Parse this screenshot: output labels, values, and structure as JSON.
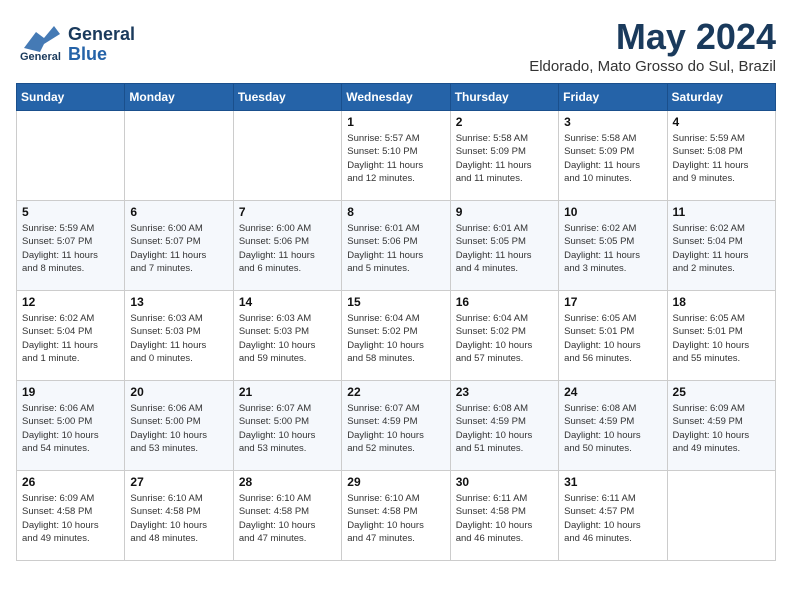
{
  "header": {
    "logo_general": "General",
    "logo_blue": "Blue",
    "month_title": "May 2024",
    "subtitle": "Eldorado, Mato Grosso do Sul, Brazil"
  },
  "days_of_week": [
    "Sunday",
    "Monday",
    "Tuesday",
    "Wednesday",
    "Thursday",
    "Friday",
    "Saturday"
  ],
  "weeks": [
    [
      {
        "day": "",
        "content": ""
      },
      {
        "day": "",
        "content": ""
      },
      {
        "day": "",
        "content": ""
      },
      {
        "day": "1",
        "content": "Sunrise: 5:57 AM\nSunset: 5:10 PM\nDaylight: 11 hours\nand 12 minutes."
      },
      {
        "day": "2",
        "content": "Sunrise: 5:58 AM\nSunset: 5:09 PM\nDaylight: 11 hours\nand 11 minutes."
      },
      {
        "day": "3",
        "content": "Sunrise: 5:58 AM\nSunset: 5:09 PM\nDaylight: 11 hours\nand 10 minutes."
      },
      {
        "day": "4",
        "content": "Sunrise: 5:59 AM\nSunset: 5:08 PM\nDaylight: 11 hours\nand 9 minutes."
      }
    ],
    [
      {
        "day": "5",
        "content": "Sunrise: 5:59 AM\nSunset: 5:07 PM\nDaylight: 11 hours\nand 8 minutes."
      },
      {
        "day": "6",
        "content": "Sunrise: 6:00 AM\nSunset: 5:07 PM\nDaylight: 11 hours\nand 7 minutes."
      },
      {
        "day": "7",
        "content": "Sunrise: 6:00 AM\nSunset: 5:06 PM\nDaylight: 11 hours\nand 6 minutes."
      },
      {
        "day": "8",
        "content": "Sunrise: 6:01 AM\nSunset: 5:06 PM\nDaylight: 11 hours\nand 5 minutes."
      },
      {
        "day": "9",
        "content": "Sunrise: 6:01 AM\nSunset: 5:05 PM\nDaylight: 11 hours\nand 4 minutes."
      },
      {
        "day": "10",
        "content": "Sunrise: 6:02 AM\nSunset: 5:05 PM\nDaylight: 11 hours\nand 3 minutes."
      },
      {
        "day": "11",
        "content": "Sunrise: 6:02 AM\nSunset: 5:04 PM\nDaylight: 11 hours\nand 2 minutes."
      }
    ],
    [
      {
        "day": "12",
        "content": "Sunrise: 6:02 AM\nSunset: 5:04 PM\nDaylight: 11 hours\nand 1 minute."
      },
      {
        "day": "13",
        "content": "Sunrise: 6:03 AM\nSunset: 5:03 PM\nDaylight: 11 hours\nand 0 minutes."
      },
      {
        "day": "14",
        "content": "Sunrise: 6:03 AM\nSunset: 5:03 PM\nDaylight: 10 hours\nand 59 minutes."
      },
      {
        "day": "15",
        "content": "Sunrise: 6:04 AM\nSunset: 5:02 PM\nDaylight: 10 hours\nand 58 minutes."
      },
      {
        "day": "16",
        "content": "Sunrise: 6:04 AM\nSunset: 5:02 PM\nDaylight: 10 hours\nand 57 minutes."
      },
      {
        "day": "17",
        "content": "Sunrise: 6:05 AM\nSunset: 5:01 PM\nDaylight: 10 hours\nand 56 minutes."
      },
      {
        "day": "18",
        "content": "Sunrise: 6:05 AM\nSunset: 5:01 PM\nDaylight: 10 hours\nand 55 minutes."
      }
    ],
    [
      {
        "day": "19",
        "content": "Sunrise: 6:06 AM\nSunset: 5:00 PM\nDaylight: 10 hours\nand 54 minutes."
      },
      {
        "day": "20",
        "content": "Sunrise: 6:06 AM\nSunset: 5:00 PM\nDaylight: 10 hours\nand 53 minutes."
      },
      {
        "day": "21",
        "content": "Sunrise: 6:07 AM\nSunset: 5:00 PM\nDaylight: 10 hours\nand 53 minutes."
      },
      {
        "day": "22",
        "content": "Sunrise: 6:07 AM\nSunset: 4:59 PM\nDaylight: 10 hours\nand 52 minutes."
      },
      {
        "day": "23",
        "content": "Sunrise: 6:08 AM\nSunset: 4:59 PM\nDaylight: 10 hours\nand 51 minutes."
      },
      {
        "day": "24",
        "content": "Sunrise: 6:08 AM\nSunset: 4:59 PM\nDaylight: 10 hours\nand 50 minutes."
      },
      {
        "day": "25",
        "content": "Sunrise: 6:09 AM\nSunset: 4:59 PM\nDaylight: 10 hours\nand 49 minutes."
      }
    ],
    [
      {
        "day": "26",
        "content": "Sunrise: 6:09 AM\nSunset: 4:58 PM\nDaylight: 10 hours\nand 49 minutes."
      },
      {
        "day": "27",
        "content": "Sunrise: 6:10 AM\nSunset: 4:58 PM\nDaylight: 10 hours\nand 48 minutes."
      },
      {
        "day": "28",
        "content": "Sunrise: 6:10 AM\nSunset: 4:58 PM\nDaylight: 10 hours\nand 47 minutes."
      },
      {
        "day": "29",
        "content": "Sunrise: 6:10 AM\nSunset: 4:58 PM\nDaylight: 10 hours\nand 47 minutes."
      },
      {
        "day": "30",
        "content": "Sunrise: 6:11 AM\nSunset: 4:58 PM\nDaylight: 10 hours\nand 46 minutes."
      },
      {
        "day": "31",
        "content": "Sunrise: 6:11 AM\nSunset: 4:57 PM\nDaylight: 10 hours\nand 46 minutes."
      },
      {
        "day": "",
        "content": ""
      }
    ]
  ]
}
